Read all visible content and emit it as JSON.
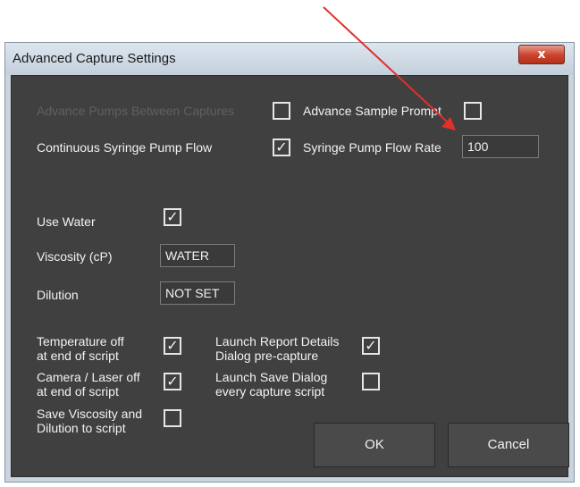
{
  "dialog": {
    "title": "Advanced Capture Settings",
    "close_label": "x",
    "checkmark": "✓",
    "options": {
      "advance_pumps_label": "Advance Pumps Between Captures",
      "advance_pumps_checked": false,
      "advance_sample_prompt_label": "Advance Sample Prompt",
      "advance_sample_prompt_checked": false,
      "continuous_flow_label": "Continuous Syringe Pump Flow",
      "continuous_flow_checked": true,
      "flow_rate_label": "Syringe Pump Flow Rate",
      "flow_rate_value": "100",
      "use_water_label": "Use Water",
      "use_water_checked": true,
      "viscosity_label": "Viscosity (cP)",
      "viscosity_value": "WATER",
      "dilution_label": "Dilution",
      "dilution_value": "NOT SET",
      "temperature_off_label": "Temperature off\nat end of script",
      "temperature_off_checked": true,
      "camera_laser_off_label": "Camera / Laser off\nat end of script",
      "camera_laser_off_checked": true,
      "save_viscosity_label": "Save Viscosity and\nDilution to script",
      "save_viscosity_checked": false,
      "launch_report_label": "Launch Report Details\nDialog pre-capture",
      "launch_report_checked": true,
      "launch_save_label": "Launch Save Dialog\nevery capture script",
      "launch_save_checked": false
    },
    "ok_label": "OK",
    "cancel_label": "Cancel"
  },
  "colors": {
    "dialog_background": "#404040",
    "annotation_arrow": "#e0302a"
  }
}
